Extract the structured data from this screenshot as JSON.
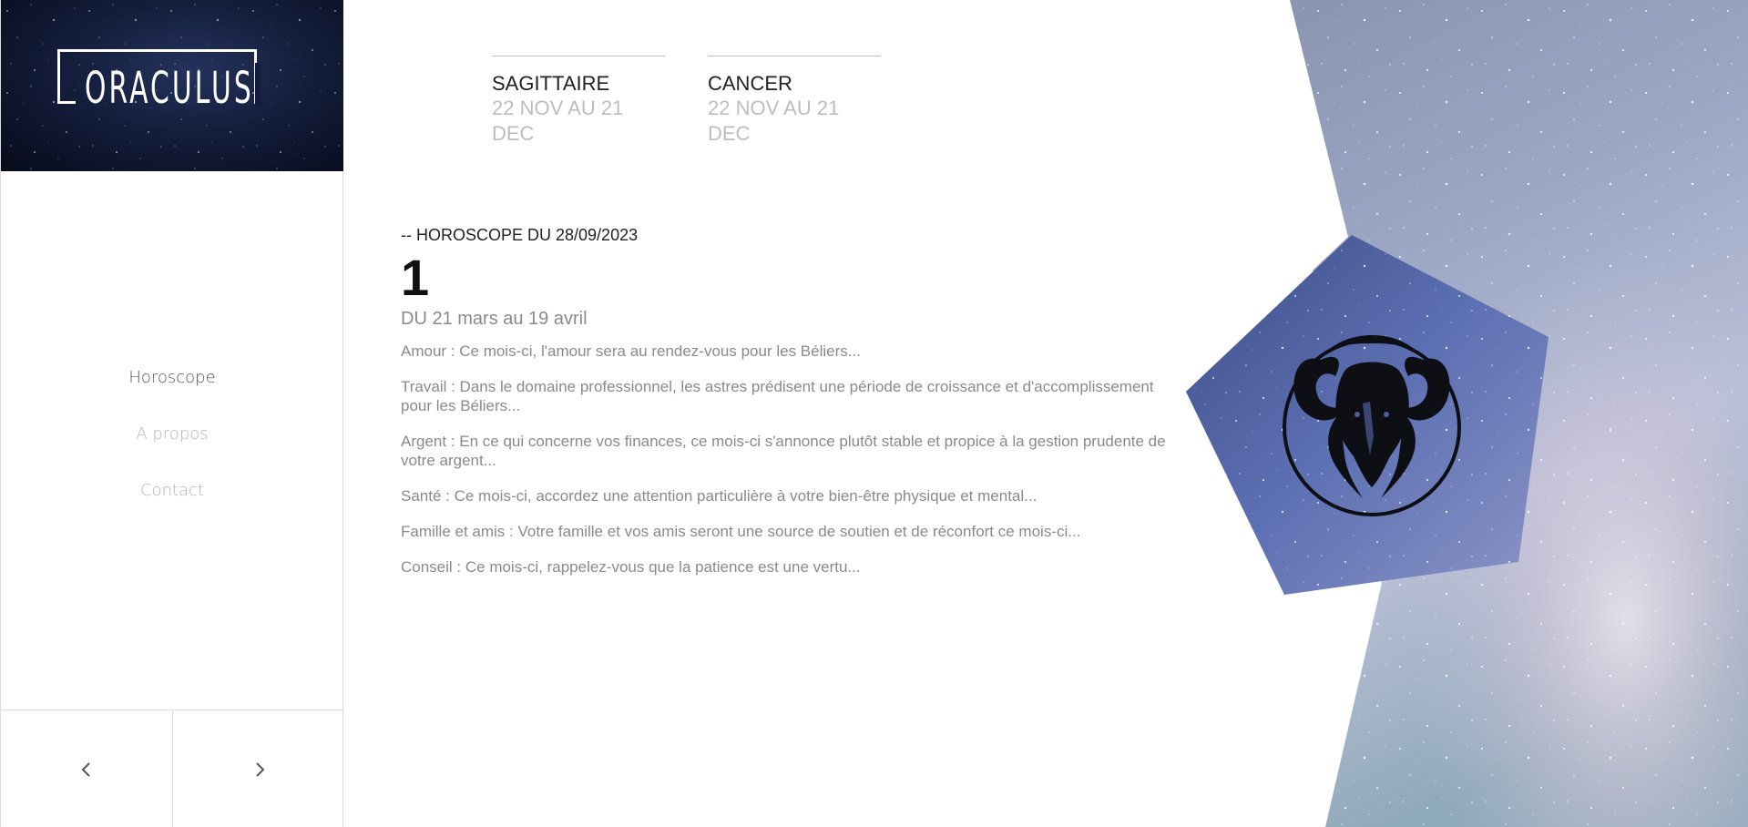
{
  "brand": {
    "logo_text": "ORACULUS"
  },
  "nav": {
    "items": [
      {
        "label": "Horoscope",
        "active": true
      },
      {
        "label": "A propos",
        "active": false
      },
      {
        "label": "Contact",
        "active": false
      }
    ]
  },
  "pager": {
    "prev_icon": "chevron-left-icon",
    "next_icon": "chevron-right-icon"
  },
  "signs": [
    {
      "name": "SAGITTAIRE",
      "dates": "22 NOV AU 21 DEC"
    },
    {
      "name": "CANCER",
      "dates": "22 NOV AU 21 DEC"
    }
  ],
  "horoscope": {
    "kicker": "-- HOROSCOPE DU 28/09/2023",
    "number": "1",
    "range": "DU 21 mars au 19 avril",
    "paragraphs": [
      "Amour : Ce mois-ci, l'amour sera au rendez-vous pour les Béliers...",
      "Travail : Dans le domaine professionnel, les astres prédisent une période de croissance et d'accomplissement pour les Béliers...",
      "Argent : En ce qui concerne vos finances, ce mois-ci s'annonce plutôt stable et propice à la gestion prudente de votre argent...",
      "Santé : Ce mois-ci, accordez une attention particulière à votre bien-être physique et mental...",
      "Famille et amis : Votre famille et vos amis seront une source de soutien et de réconfort ce mois-ci...",
      "Conseil : Ce mois-ci, rappelez-vous que la patience est une vertu..."
    ],
    "zodiac_icon": "aries-ram-icon"
  },
  "colors": {
    "night_sky": "#141e3c",
    "galaxy_light": "#c9d1e6",
    "pentagon_blue": "#5e72b3",
    "muted_text": "#8a8a8a"
  }
}
